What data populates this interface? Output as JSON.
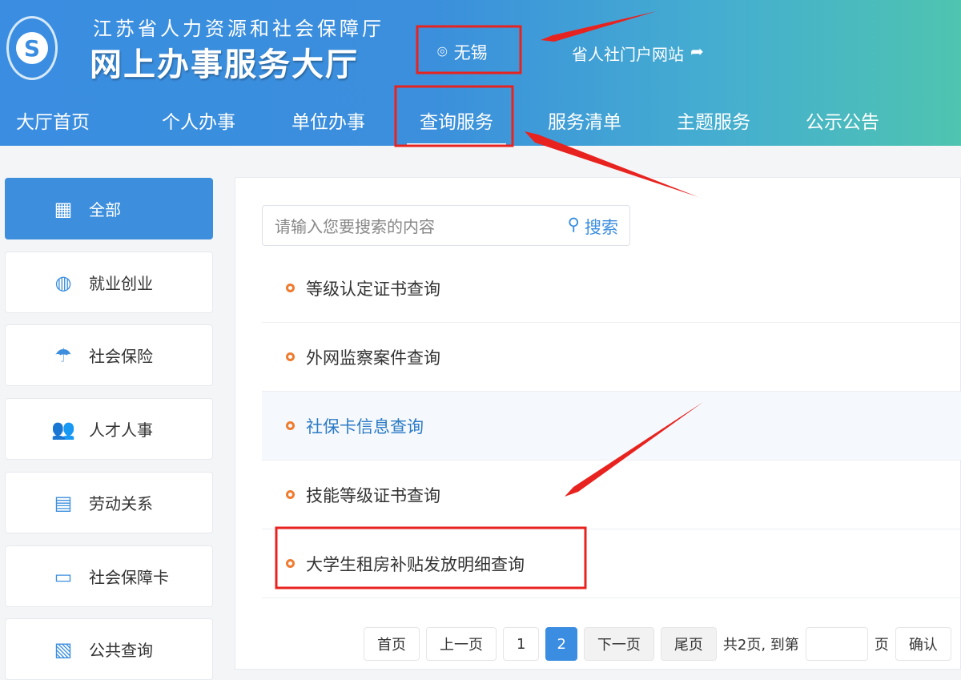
{
  "header": {
    "org": "江苏省人力资源和社会保障厅",
    "title": "网上办事服务大厅",
    "location": "无锡",
    "portal": "省人社门户网站"
  },
  "nav": [
    "大厅首页",
    "个人办事",
    "单位办事",
    "查询服务",
    "服务清单",
    "主题服务",
    "公示公告"
  ],
  "sidebar": [
    {
      "label": "全部",
      "icon": "grid-icon"
    },
    {
      "label": "就业创业",
      "icon": "tie-icon"
    },
    {
      "label": "社会保险",
      "icon": "umbrella-icon"
    },
    {
      "label": "人才人事",
      "icon": "people-icon"
    },
    {
      "label": "劳动关系",
      "icon": "document-icon"
    },
    {
      "label": "社会保障卡",
      "icon": "card-icon"
    },
    {
      "label": "公共查询",
      "icon": "search-doc-icon"
    }
  ],
  "search": {
    "placeholder": "请输入您要搜索的内容",
    "button": "搜索"
  },
  "list": [
    "等级认定证书查询",
    "外网监察案件查询",
    "社保卡信息查询",
    "技能等级证书查询",
    "大学生租房补贴发放明细查询"
  ],
  "pagination": {
    "first": "首页",
    "prev": "上一页",
    "pages": [
      "1",
      "2"
    ],
    "next": "下一页",
    "last": "尾页",
    "total": "共2页, 到第",
    "page_unit": "页",
    "confirm": "确认"
  }
}
